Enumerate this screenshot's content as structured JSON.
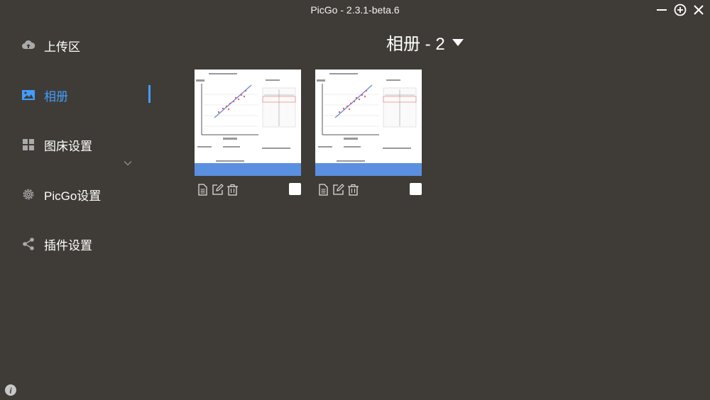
{
  "window": {
    "title": "PicGo - 2.3.1-beta.6"
  },
  "sidebar": {
    "items": [
      {
        "label": "上传区",
        "icon": "cloud-upload-icon"
      },
      {
        "label": "相册",
        "icon": "image-icon",
        "active": true
      },
      {
        "label": "图床设置",
        "icon": "grid-icon",
        "expandable": true
      },
      {
        "label": "PicGo设置",
        "icon": "gear-icon"
      },
      {
        "label": "插件设置",
        "icon": "share-icon"
      }
    ]
  },
  "album": {
    "title": "相册 - 2"
  },
  "gallery": {
    "images": [
      {
        "thumbnail": "chart-thumbnail",
        "checked": false
      },
      {
        "thumbnail": "chart-thumbnail",
        "checked": false
      }
    ]
  },
  "colors": {
    "background": "#3f3c37",
    "accent": "#409eff",
    "text": "#ffffff"
  }
}
